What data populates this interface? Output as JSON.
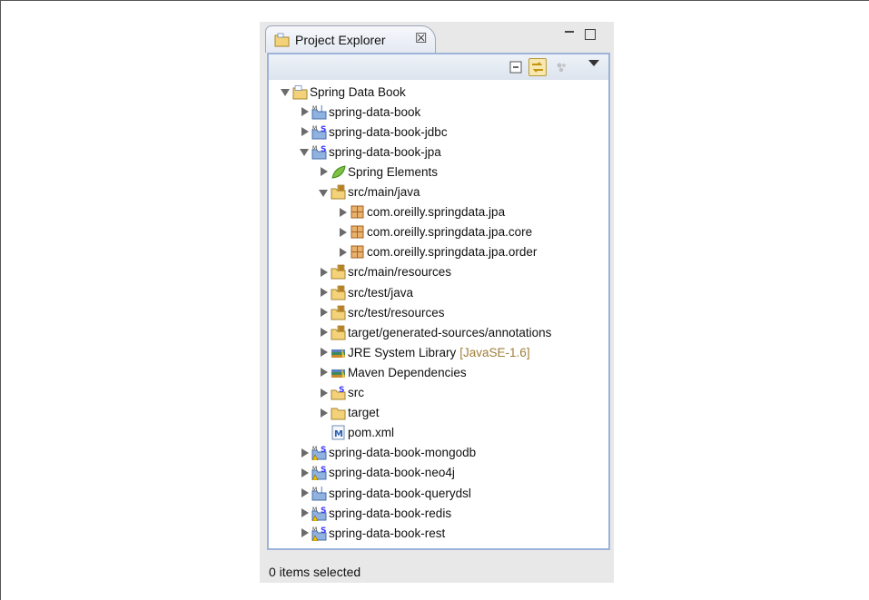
{
  "panel": {
    "tab_title": "Project Explorer",
    "tab_close_glyph": "☒"
  },
  "tree": [
    {
      "label": "Spring Data Book",
      "depth": 0,
      "state": "expanded",
      "icon": "working-set-folder-icon"
    },
    {
      "label": "spring-data-book",
      "depth": 1,
      "state": "collapsed",
      "icon": "maven-project-icon"
    },
    {
      "label": "spring-data-book-jdbc",
      "depth": 1,
      "state": "collapsed",
      "icon": "spring-maven-project-icon"
    },
    {
      "label": "spring-data-book-jpa",
      "depth": 1,
      "state": "expanded",
      "icon": "spring-maven-project-icon"
    },
    {
      "label": "Spring Elements",
      "depth": 2,
      "state": "collapsed",
      "icon": "spring-leaf-icon"
    },
    {
      "label": "src/main/java",
      "depth": 2,
      "state": "expanded",
      "icon": "source-folder-icon"
    },
    {
      "label": "com.oreilly.springdata.jpa",
      "depth": 3,
      "state": "collapsed",
      "icon": "package-icon"
    },
    {
      "label": "com.oreilly.springdata.jpa.core",
      "depth": 3,
      "state": "collapsed",
      "icon": "package-icon"
    },
    {
      "label": "com.oreilly.springdata.jpa.order",
      "depth": 3,
      "state": "collapsed",
      "icon": "package-icon"
    },
    {
      "label": "src/main/resources",
      "depth": 2,
      "state": "collapsed",
      "icon": "source-folder-icon"
    },
    {
      "label": "src/test/java",
      "depth": 2,
      "state": "collapsed",
      "icon": "source-folder-icon"
    },
    {
      "label": "src/test/resources",
      "depth": 2,
      "state": "collapsed",
      "icon": "source-folder-icon"
    },
    {
      "label": "target/generated-sources/annotations",
      "depth": 2,
      "state": "collapsed",
      "icon": "source-folder-icon"
    },
    {
      "label": "JRE System Library",
      "suffix": "[JavaSE-1.6]",
      "depth": 2,
      "state": "collapsed",
      "icon": "library-icon"
    },
    {
      "label": "Maven Dependencies",
      "depth": 2,
      "state": "collapsed",
      "icon": "library-icon"
    },
    {
      "label": "src",
      "depth": 2,
      "state": "collapsed",
      "icon": "spring-folder-icon"
    },
    {
      "label": "target",
      "depth": 2,
      "state": "collapsed",
      "icon": "folder-icon"
    },
    {
      "label": "pom.xml",
      "depth": 2,
      "state": "none",
      "icon": "maven-pom-icon"
    },
    {
      "label": "spring-data-book-mongodb",
      "depth": 1,
      "state": "collapsed",
      "icon": "spring-maven-warning-project-icon"
    },
    {
      "label": "spring-data-book-neo4j",
      "depth": 1,
      "state": "collapsed",
      "icon": "spring-maven-warning-project-icon"
    },
    {
      "label": "spring-data-book-querydsl",
      "depth": 1,
      "state": "collapsed",
      "icon": "maven-project-icon"
    },
    {
      "label": "spring-data-book-redis",
      "depth": 1,
      "state": "collapsed",
      "icon": "spring-maven-warning-project-icon"
    },
    {
      "label": "spring-data-book-rest",
      "depth": 1,
      "state": "collapsed",
      "icon": "spring-maven-warning-project-icon"
    }
  ],
  "status_text": "0 items selected"
}
